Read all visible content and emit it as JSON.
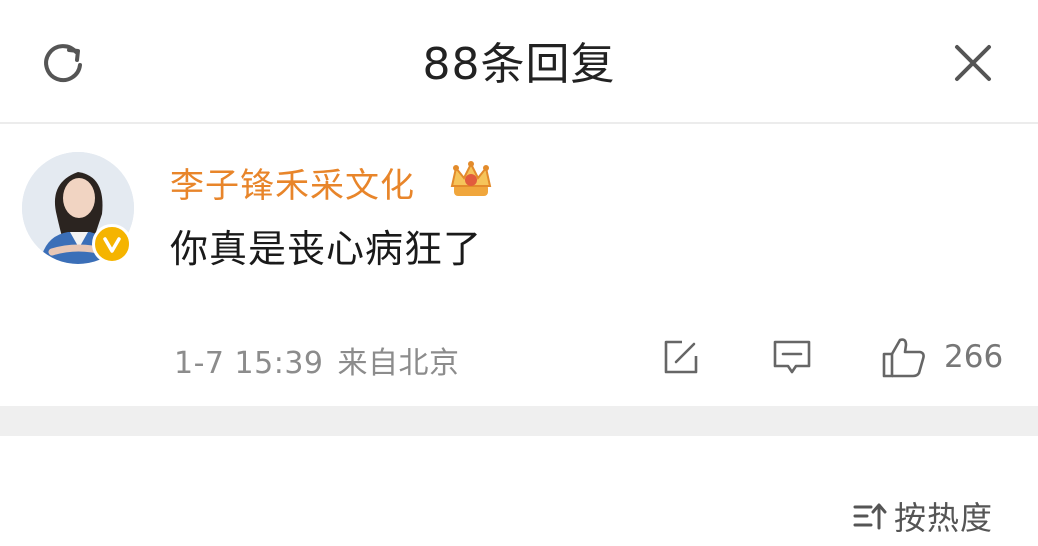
{
  "header": {
    "title": "88条回复",
    "refresh_icon": "refresh-icon",
    "close_icon": "close-icon"
  },
  "comment": {
    "username": "李子锋禾采文化",
    "username_color": "#e8852a",
    "text": "你真是丧心病狂了",
    "timestamp": "1-7 15:39",
    "location": "来自北京",
    "like_count": "266",
    "badge_icon": "verified-icon",
    "crown_icon": "crown-icon"
  },
  "footer": {
    "sort_label": "按热度",
    "sort_icon": "sort-icon"
  },
  "colors": {
    "accent_orange": "#e8852a",
    "verified_gold": "#f5b400",
    "divider": "#efefef"
  }
}
